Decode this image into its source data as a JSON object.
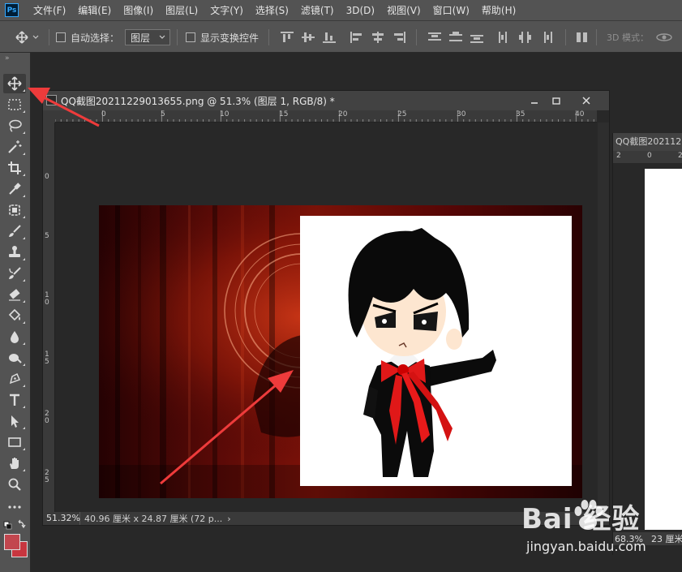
{
  "app": {
    "logo": "Ps"
  },
  "menu": [
    "文件(F)",
    "编辑(E)",
    "图像(I)",
    "图层(L)",
    "文字(Y)",
    "选择(S)",
    "滤镜(T)",
    "3D(D)",
    "视图(V)",
    "窗口(W)",
    "帮助(H)"
  ],
  "options": {
    "auto_select_label": "自动选择：",
    "auto_select_target": "图层",
    "show_transform_label": "显示变换控件",
    "mode_3d_label": "3D 模式："
  },
  "tools": [
    "move-icon",
    "marquee-icon",
    "lasso-icon",
    "magic-wand-icon",
    "crop-icon",
    "eyedropper-icon",
    "healing-brush-icon",
    "brush-icon",
    "clone-stamp-icon",
    "history-brush-icon",
    "eraser-icon",
    "paint-bucket-icon",
    "blur-icon",
    "dodge-icon",
    "pen-icon",
    "type-icon",
    "path-selection-icon",
    "rectangle-icon",
    "hand-icon",
    "zoom-icon",
    "more-tools-icon"
  ],
  "colors": {
    "foreground": "#c2464e",
    "background": "#c8363f",
    "annotation_arrow": "#ee3b3b"
  },
  "document": {
    "title": "QQ截图20211229013655.png @ 51.3% (图层 1, RGB/8) *",
    "zoom": "51.32%",
    "info": "40.96 厘米 x 24.87 厘米 (72 p...",
    "info_arrow": "›",
    "ruler_top": [
      "0",
      "5",
      "10",
      "15",
      "20",
      "25",
      "30",
      "35",
      "40"
    ],
    "ruler_left": [
      "0",
      "5",
      "10",
      "15",
      "20",
      "25"
    ]
  },
  "document2": {
    "title": "QQ截图2021122",
    "ruler": [
      "2",
      "0",
      "2"
    ],
    "zoom": "68.3%",
    "info": "23 厘米"
  },
  "watermark": {
    "logo": "Bai  经验",
    "url": "jingyan.baidu.com"
  }
}
